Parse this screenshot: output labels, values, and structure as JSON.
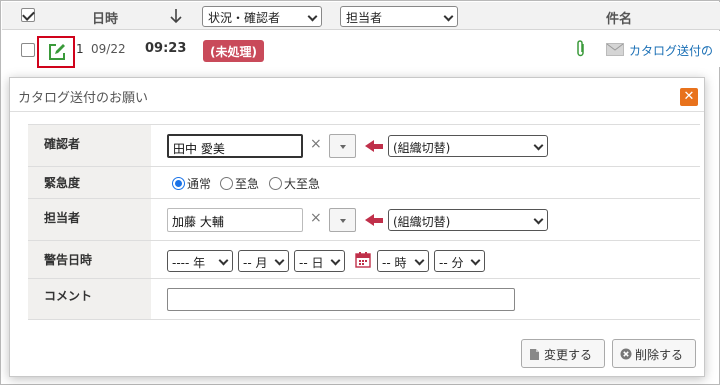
{
  "list": {
    "header": {
      "date_label": "日時",
      "status_filter": "状況・確認者",
      "assignee_filter": "担当者",
      "subject_label": "件名"
    },
    "row": {
      "count": "1",
      "date": "09/22",
      "time": "09:23",
      "status_badge": "(未処理)",
      "subject": "カタログ送付の"
    }
  },
  "dialog": {
    "title": "カタログ送付のお願い",
    "close_glyph": "✕",
    "fields": {
      "confirmer": {
        "label": "確認者",
        "value": "田中 愛美",
        "org_select": "(組織切替)"
      },
      "urgency": {
        "label": "緊急度",
        "options": [
          "通常",
          "至急",
          "大至急"
        ],
        "selected": "通常"
      },
      "assignee": {
        "label": "担当者",
        "value": "加藤 大輔",
        "org_select": "(組織切替)"
      },
      "alert_datetime": {
        "label": "警告日時",
        "year": "---- 年",
        "month": "-- 月",
        "day": "-- 日",
        "hour": "-- 時",
        "minute": "-- 分"
      },
      "comment": {
        "label": "コメント",
        "value": ""
      }
    },
    "buttons": {
      "change": "変更する",
      "delete": "削除する"
    }
  },
  "colors": {
    "badge": "#c94a5a",
    "close": "#e8721c",
    "arrow": "#c0304a",
    "link": "#1a6fb5"
  }
}
